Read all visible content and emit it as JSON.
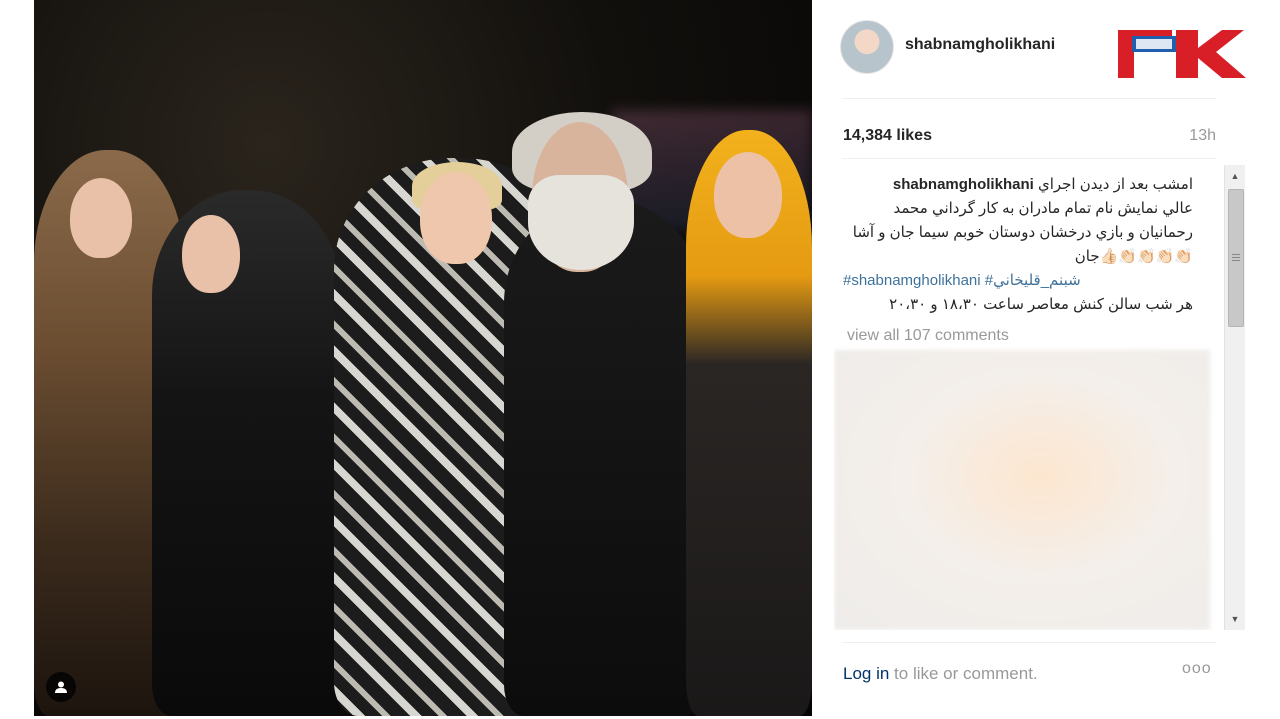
{
  "post": {
    "username": "shabnamgholikhani",
    "likes": "14,384 likes",
    "time": "13h",
    "caption": {
      "username": "shabnamgholikhani",
      "line1": "امشب بعد از ديدن اجراي",
      "line2": "عالي نمايش نام تمام مادران به كار گرداني محمد",
      "line3": "رحمانيان و بازي درخشان دوستان خوبم سيما جان و آشا",
      "line4": "👏🏻👏🏻👏🏻👏🏻👍🏻جان",
      "hashtags": "#shabnamgholikhani #شبنم_قليخاني",
      "line6": "هر شب سالن كنش معاصر ساعت ١٨،٣٠ و ٢٠،٣٠"
    },
    "comments_link": "view all 107 comments",
    "login_link": "Log in",
    "login_text": " to like or comment.",
    "more": "ooo"
  },
  "icons": {
    "user_tag": "person-icon",
    "scroll_up": "arrow-up-icon",
    "scroll_down": "arrow-down-icon",
    "more_options": "more-options-icon",
    "logo": "rokna-logo"
  },
  "colors": {
    "link": "#003569",
    "hashtag": "#3f729b",
    "muted": "#999999",
    "logo_red": "#d81e27"
  }
}
